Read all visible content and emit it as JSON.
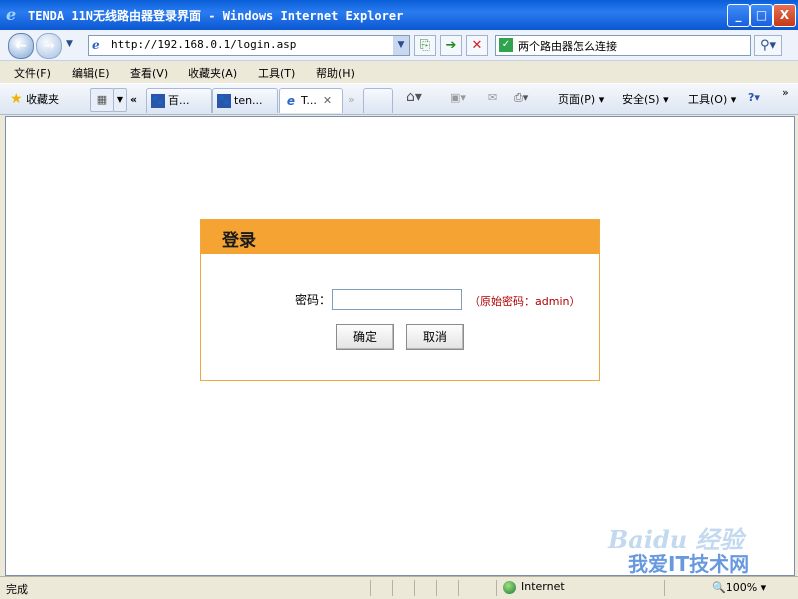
{
  "window": {
    "title": "TENDA 11N无线路由器登录界面 - Windows Internet Explorer",
    "min": "_",
    "max": "□",
    "close": "X"
  },
  "nav": {
    "url": "http://192.168.0.1/login.asp",
    "search_text": "两个路由器怎么连接"
  },
  "menu": [
    "文件(F)",
    "编辑(E)",
    "查看(V)",
    "收藏夹(A)",
    "工具(T)",
    "帮助(H)"
  ],
  "tabs": {
    "favorites_label": "收藏夹",
    "items": [
      {
        "label": "百..."
      },
      {
        "label": "ten..."
      },
      {
        "label": "T..."
      }
    ],
    "commands": [
      "页面(P)",
      "安全(S)",
      "工具(O)"
    ]
  },
  "login": {
    "title": "登录",
    "password_label": "密码：",
    "hint": "（原始密码：admin）",
    "ok_button": "确定",
    "cancel_button": "取消"
  },
  "status": {
    "text": "完成",
    "zone": "Internet",
    "zoom": "100%"
  },
  "watermark": {
    "line1": "Baidu 经验",
    "line2": "我爱IT技术网"
  }
}
